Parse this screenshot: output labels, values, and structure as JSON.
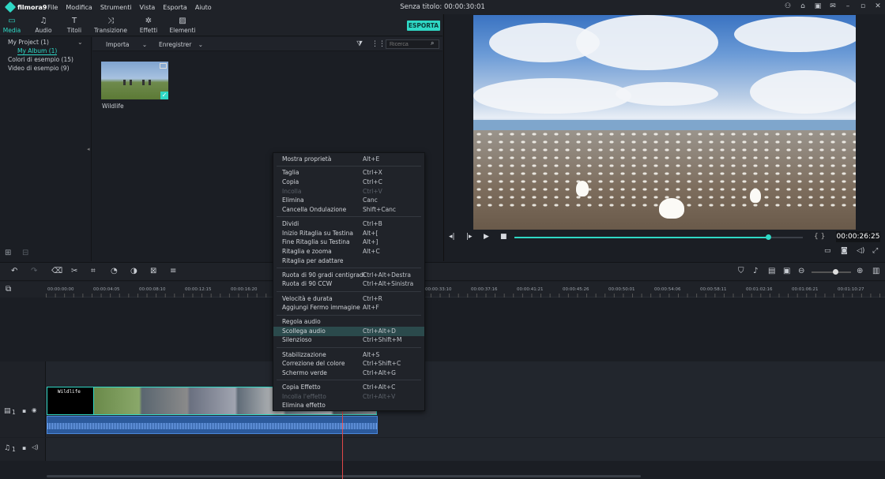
{
  "app": {
    "name": "filmora9",
    "title": "Senza titolo:",
    "title_time": "00:00:30:01"
  },
  "menubar": {
    "items": [
      "File",
      "Modifica",
      "Strumenti",
      "Vista",
      "Esporta",
      "Aiuto"
    ]
  },
  "tabs": [
    {
      "label": "Media",
      "icon": "folder-icon",
      "glyph": "▭"
    },
    {
      "label": "Audio",
      "icon": "music-note-icon",
      "glyph": "♫"
    },
    {
      "label": "Titoli",
      "icon": "text-icon",
      "glyph": "T"
    },
    {
      "label": "Transizione",
      "icon": "transition-icon",
      "glyph": "⤨"
    },
    {
      "label": "Effetti",
      "icon": "effects-icon",
      "glyph": "✲"
    },
    {
      "label": "Elementi",
      "icon": "image-icon",
      "glyph": "▨"
    }
  ],
  "export_button": "ESPORTA",
  "sidebar": {
    "items": [
      {
        "label": "My Project (1)"
      },
      {
        "label": "My Album (1)"
      },
      {
        "label": "Colori di esempio (15)"
      },
      {
        "label": "Video di esempio (9)"
      }
    ]
  },
  "media_toolbar": {
    "import_label": "Importa",
    "record_label": "Enregistrer",
    "search_placeholder": "Ricerca"
  },
  "media_items": [
    {
      "label": "Wildlife"
    }
  ],
  "preview": {
    "timecode": "00:00:26:25",
    "progress": 0.88,
    "brackets": "{  }"
  },
  "ruler": {
    "labels": [
      "00:00:00:00",
      "00:00:04:05",
      "00:00:08:10",
      "00:00:12:15",
      "00:00:16:20",
      "00:00:33:10",
      "00:00:37:16",
      "00:00:41:21",
      "00:00:45:26",
      "00:00:50:01",
      "00:00:54:06",
      "00:00:58:11",
      "00:01:02:16",
      "00:01:06:21",
      "00:01:10:27"
    ]
  },
  "tracks": {
    "video_label": "1",
    "audio_label": "1",
    "title_clip_text": "Wildlife"
  },
  "context_menu": {
    "items": [
      {
        "label": "Mostra proprietà",
        "shortcut": "Alt+E",
        "state": "normal"
      },
      {
        "label": "Taglia",
        "shortcut": "Ctrl+X",
        "state": "normal"
      },
      {
        "label": "Copia",
        "shortcut": "Ctrl+C",
        "state": "normal"
      },
      {
        "label": "Incolla",
        "shortcut": "Ctrl+V",
        "state": "disabled"
      },
      {
        "label": "Elimina",
        "shortcut": "Canc",
        "state": "normal"
      },
      {
        "label": "Cancella Ondulazione",
        "shortcut": "Shift+Canc",
        "state": "normal"
      },
      {
        "label": "Dividi",
        "shortcut": "Ctrl+B",
        "state": "normal"
      },
      {
        "label": "Inizio Ritaglia su Testina",
        "shortcut": "Alt+[",
        "state": "normal"
      },
      {
        "label": "Fine Ritaglia su Testina",
        "shortcut": "Alt+]",
        "state": "normal"
      },
      {
        "label": "Ritaglia e zooma",
        "shortcut": "Alt+C",
        "state": "normal"
      },
      {
        "label": "Ritaglia per adattare",
        "shortcut": "",
        "state": "normal"
      },
      {
        "label": "Ruota di 90 gradi centigradi",
        "shortcut": "Ctrl+Alt+Destra",
        "state": "normal"
      },
      {
        "label": "Ruota di 90 CCW",
        "shortcut": "Ctrl+Alt+Sinistra",
        "state": "normal"
      },
      {
        "label": "Velocità e durata",
        "shortcut": "Ctrl+R",
        "state": "normal"
      },
      {
        "label": "Aggiungi Fermo immagine",
        "shortcut": "Alt+F",
        "state": "normal"
      },
      {
        "label": "Regola audio",
        "shortcut": "",
        "state": "normal"
      },
      {
        "label": "Scollega audio",
        "shortcut": "Ctrl+Alt+D",
        "state": "highlighted"
      },
      {
        "label": "Silenzioso",
        "shortcut": "Ctrl+Shift+M",
        "state": "normal"
      },
      {
        "label": "Stabilizzazione",
        "shortcut": "Alt+S",
        "state": "normal"
      },
      {
        "label": "Correzione del colore",
        "shortcut": "Ctrl+Shift+C",
        "state": "normal"
      },
      {
        "label": "Schermo verde",
        "shortcut": "Ctrl+Alt+G",
        "state": "normal"
      },
      {
        "label": "Copia Effetto",
        "shortcut": "Ctrl+Alt+C",
        "state": "normal"
      },
      {
        "label": "Incolla l'effetto",
        "shortcut": "Ctrl+Alt+V",
        "state": "disabled"
      },
      {
        "label": "Elimina effetto",
        "shortcut": "",
        "state": "normal"
      }
    ]
  },
  "colors": {
    "accent": "#2fd8c5",
    "playhead": "#e04848",
    "audio_clip": "#2c5a9c"
  }
}
